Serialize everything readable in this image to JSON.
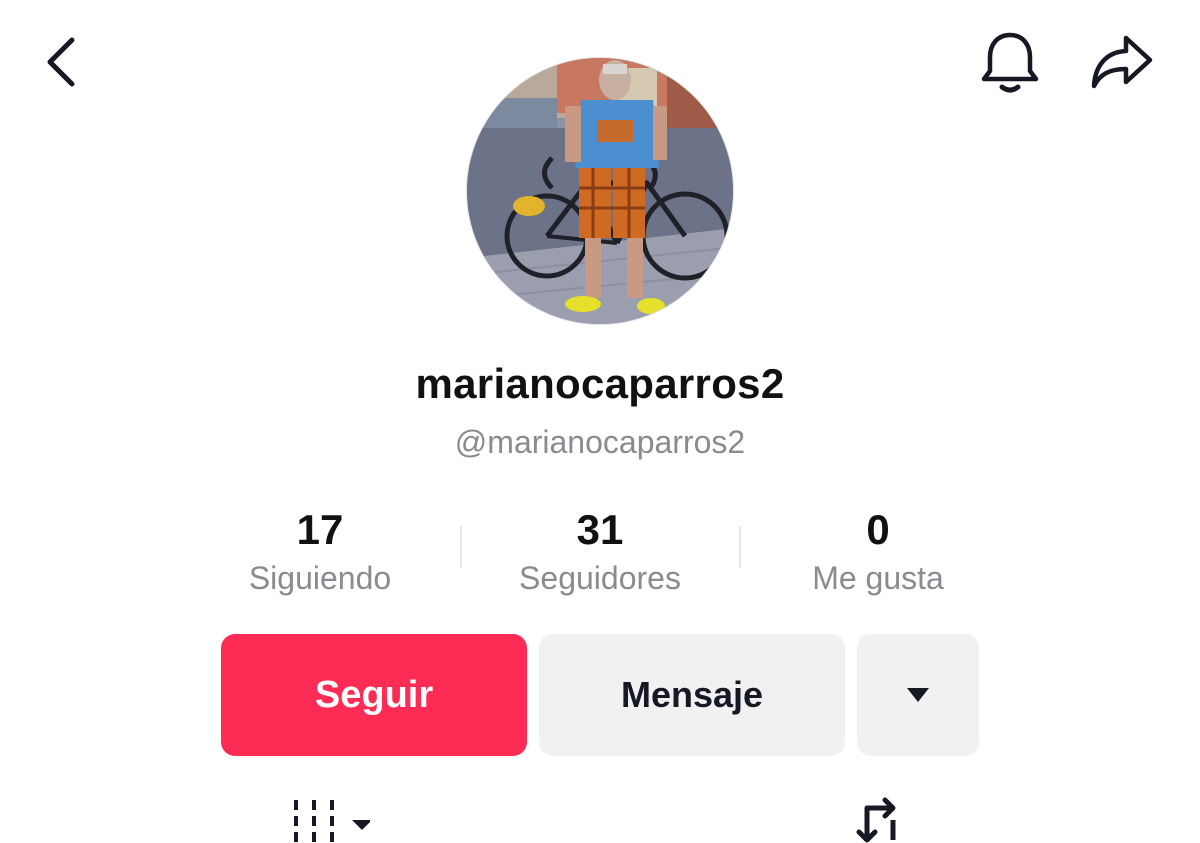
{
  "header": {
    "back_icon": "chevron-left-icon",
    "notification_icon": "bell-icon",
    "share_icon": "share-arrow-icon"
  },
  "profile": {
    "display_name": "marianocaparros2",
    "handle": "@marianocaparros2",
    "avatar": "profile photo: person standing with a road bicycle on a city street"
  },
  "stats": [
    {
      "value": "17",
      "label": "Siguiendo"
    },
    {
      "value": "31",
      "label": "Seguidores"
    },
    {
      "value": "0",
      "label": "Me gusta"
    }
  ],
  "actions": {
    "follow_label": "Seguir",
    "message_label": "Mensaje",
    "more_icon": "caret-down-icon"
  },
  "tabs": {
    "videos_icon": "grid-icon",
    "reposts_icon": "repost-icon"
  },
  "colors": {
    "accent": "#fe2c55",
    "secondary_button": "#f1f1f2",
    "muted_text": "#8a8b91"
  }
}
